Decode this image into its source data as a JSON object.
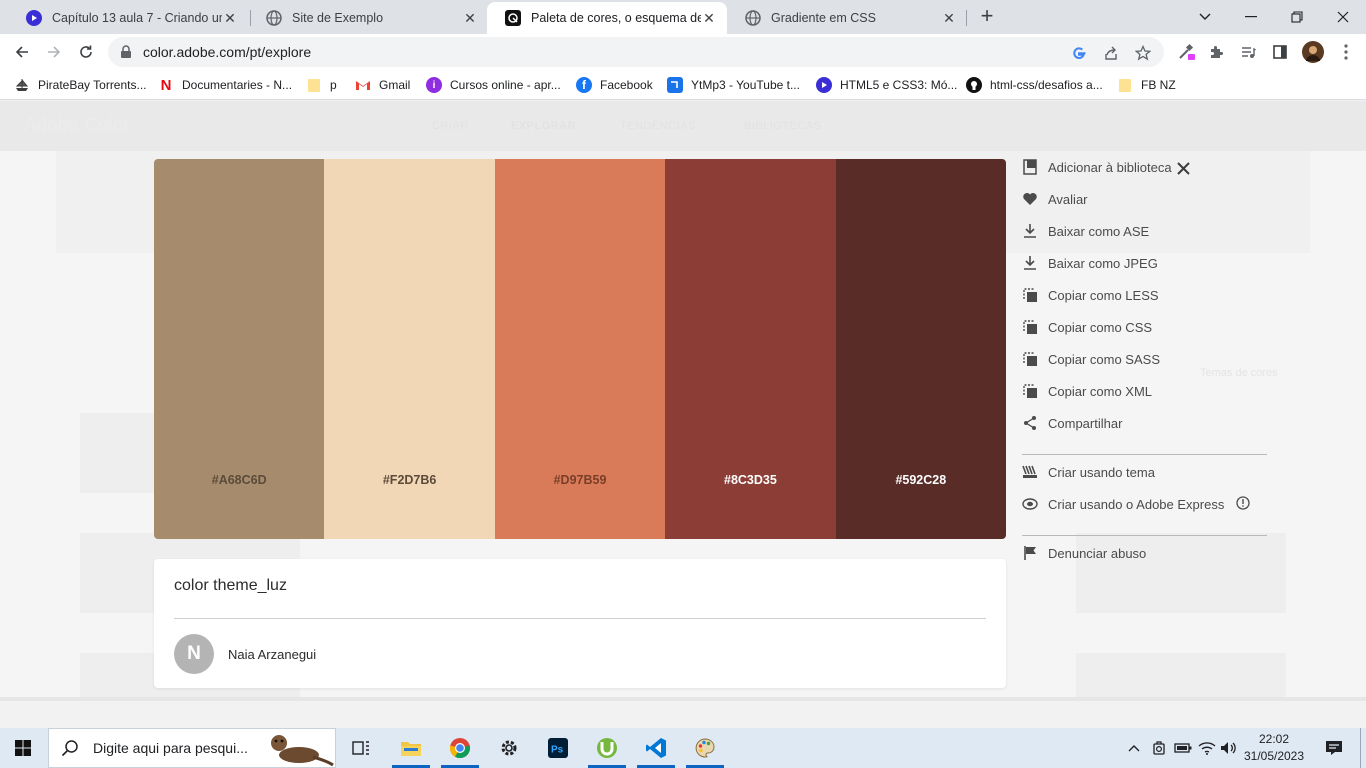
{
  "browser": {
    "tabs": [
      {
        "title": "Capítulo 13 aula 7 - Criando um s",
        "favicon": "twitch-like-icon"
      },
      {
        "title": "Site de Exemplo",
        "favicon": "globe-icon"
      },
      {
        "title": "Paleta de cores, o esquema de co",
        "favicon": "adobe-color-icon"
      },
      {
        "title": "Gradiente em CSS",
        "favicon": "globe-icon"
      }
    ],
    "new_tab": "+",
    "url": "color.adobe.com/pt/explore",
    "bookmarks": [
      {
        "label": "PirateBay Torrents..."
      },
      {
        "label": "Documentaries - N..."
      },
      {
        "label": "p"
      },
      {
        "label": "Gmail"
      },
      {
        "label": "Cursos online - apr..."
      },
      {
        "label": "Facebook"
      },
      {
        "label": "YtMp3 - YouTube t..."
      },
      {
        "label": "HTML5 e CSS3: Mó..."
      },
      {
        "label": "html-css/desafios a..."
      },
      {
        "label": "FB NZ"
      }
    ]
  },
  "background_page": {
    "logo": "Adobe Color",
    "nav": [
      "CRIAR",
      "EXPLORAR",
      "TENDÊNCIAS",
      "BIBLIOTECAS"
    ],
    "sort_label": "Temas de cores"
  },
  "palette": {
    "swatches": [
      {
        "hex": "#A68C6D",
        "color": "#A68C6D",
        "text_color": "#5a4b3a"
      },
      {
        "hex": "#F2D7B6",
        "color": "#F2D7B6",
        "text_color": "#5a4b3a"
      },
      {
        "hex": "#D97B59",
        "color": "#D97B59",
        "text_color": "#7a3e28"
      },
      {
        "hex": "#8C3D35",
        "color": "#8C3D35",
        "text_color": "#ffffff"
      },
      {
        "hex": "#592C28",
        "color": "#592C28",
        "text_color": "#ffffff"
      }
    ]
  },
  "theme": {
    "name": "color theme_luz",
    "author_initial": "N",
    "author": "Naia Arzanegui"
  },
  "actions": [
    {
      "label": "Adicionar à biblioteca",
      "icon": "library-icon"
    },
    {
      "label": "Avaliar",
      "icon": "heart-icon"
    },
    {
      "label": "Baixar como ASE",
      "icon": "download-icon"
    },
    {
      "label": "Baixar como JPEG",
      "icon": "download-icon"
    },
    {
      "label": "Copiar como LESS",
      "icon": "copy-icon"
    },
    {
      "label": "Copiar como CSS",
      "icon": "copy-icon"
    },
    {
      "label": "Copiar como SASS",
      "icon": "copy-icon"
    },
    {
      "label": "Copiar como XML",
      "icon": "copy-icon"
    },
    {
      "label": "Compartilhar",
      "icon": "share-icon"
    },
    {
      "label": "Criar usando tema",
      "icon": "brush-icon"
    },
    {
      "label": "Criar usando o Adobe Express",
      "icon": "adobe-express-icon"
    },
    {
      "label": "Denunciar abuso",
      "icon": "flag-icon"
    }
  ],
  "taskbar": {
    "search_placeholder": "Digite aqui para pesqui...",
    "time": "22:02",
    "date": "31/05/2023"
  }
}
